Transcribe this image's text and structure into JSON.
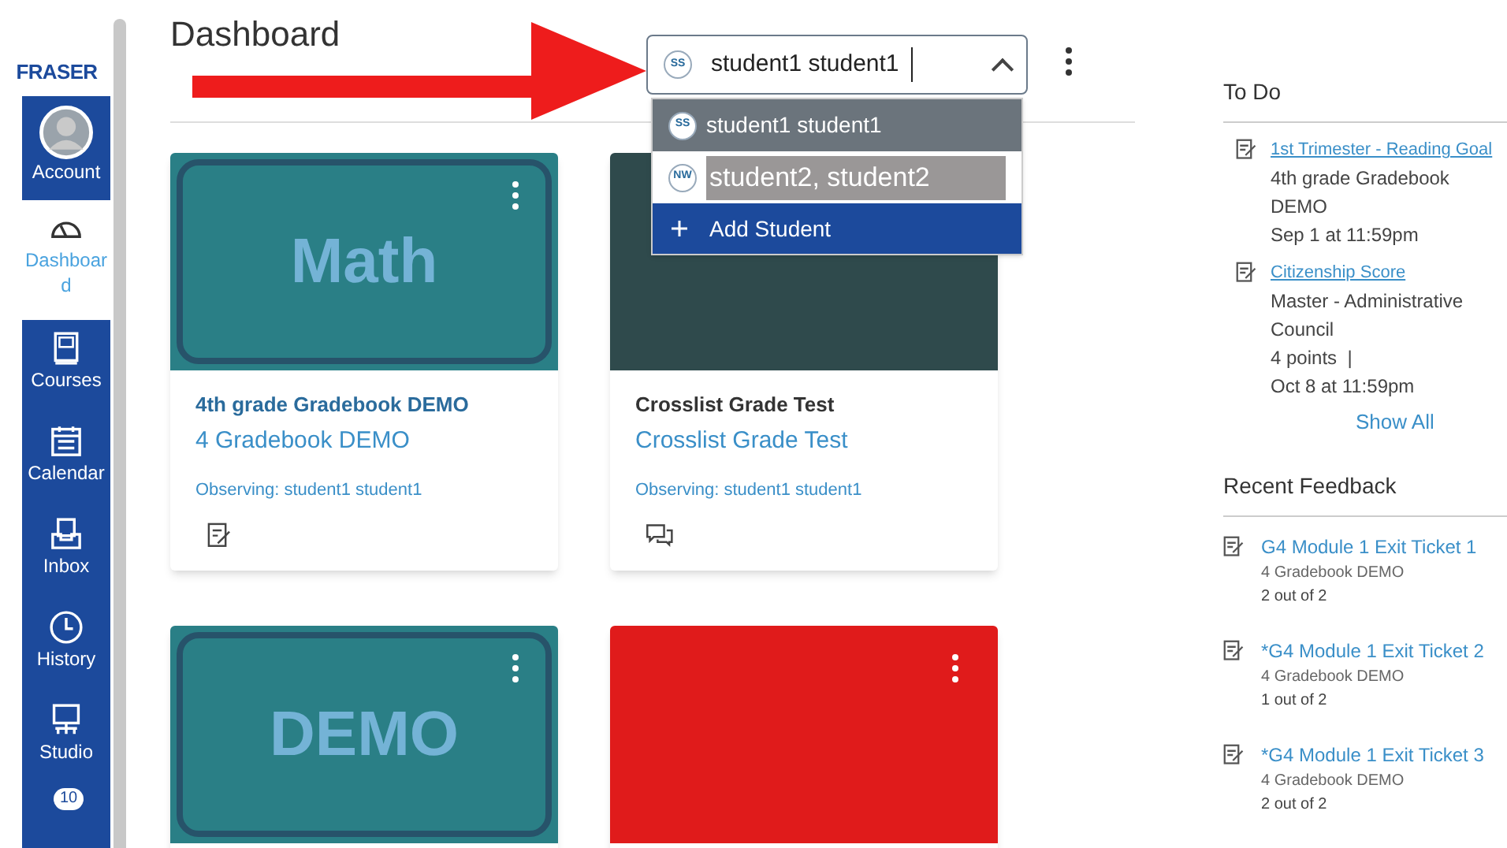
{
  "sidebar": {
    "logo": "FRASER",
    "items": [
      {
        "label": "Account",
        "kind": "avatar",
        "selected": false
      },
      {
        "label": "Dashboard",
        "kind": "gauge",
        "selected": true
      },
      {
        "label": "Courses",
        "kind": "book",
        "selected": false
      },
      {
        "label": "Calendar",
        "kind": "calendar",
        "selected": false
      },
      {
        "label": "Inbox",
        "kind": "inbox",
        "selected": false
      },
      {
        "label": "History",
        "kind": "clock",
        "selected": false
      },
      {
        "label": "Studio",
        "kind": "studio",
        "selected": false
      }
    ],
    "partial_badge": "10"
  },
  "header": {
    "title": "Dashboard"
  },
  "student_picker": {
    "value": "student1 student1",
    "initials": "SS",
    "expanded": true,
    "options": [
      {
        "label": "student1 student1",
        "initials": "SS",
        "selected": true
      },
      {
        "label": "student2, student2",
        "initials": "NW",
        "selected": false
      }
    ],
    "add_label": "Add Student"
  },
  "cards": [
    {
      "image_label": "Math",
      "color": "#2a7f86",
      "title": "4th grade Gradebook DEMO",
      "title_link": true,
      "subtitle": "4 Gradebook DEMO",
      "observing": "Observing: student1 student1",
      "kind": "assignment",
      "menu": true
    },
    {
      "color": "#2f4a4c",
      "title": "Crosslist Grade Test",
      "title_link": false,
      "subtitle": "Crosslist Grade Test",
      "observing": "Observing: student1 student1",
      "kind": "discussion",
      "menu": false
    },
    {
      "image_label": "DEMO",
      "color": "#2a7f86",
      "menu": true
    },
    {
      "color": "#e01b1b",
      "menu": true
    }
  ],
  "todo": {
    "heading": "To Do",
    "items": [
      {
        "title": "1st Trimester - Reading Goal",
        "lines": [
          "4th grade Gradebook DEMO",
          "Sep 1 at 11:59pm"
        ]
      },
      {
        "title": "Citizenship Score",
        "lines": [
          "Master - Administrative Council",
          "4 points  |",
          "Oct 8 at 11:59pm"
        ]
      }
    ],
    "show_all": "Show All"
  },
  "recent_feedback": {
    "heading": "Recent Feedback",
    "items": [
      {
        "title": "G4 Module 1 Exit Ticket 1",
        "course": "4 Gradebook DEMO",
        "score": "2 out of 2"
      },
      {
        "title": "*G4 Module 1 Exit Ticket 2",
        "course": "4 Gradebook DEMO",
        "score": "1 out of 2"
      },
      {
        "title": "*G4 Module 1 Exit Ticket 3",
        "course": "4 Gradebook DEMO",
        "score": "2 out of 2"
      }
    ]
  }
}
